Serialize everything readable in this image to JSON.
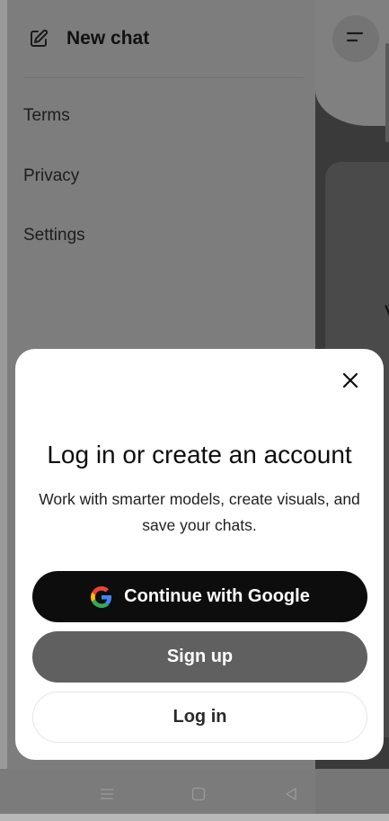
{
  "sidebar": {
    "new_chat_label": "New chat",
    "new_chat_icon": "edit-icon",
    "links": {
      "terms": "Terms",
      "privacy": "Privacy",
      "settings": "Settings"
    }
  },
  "main": {
    "menu_icon": "menu-icon",
    "partial_text": "V"
  },
  "modal": {
    "title": "Log in or create an account",
    "subtitle": "Work with smarter models, create visuals, and save your chats.",
    "close_icon": "close-icon",
    "google_button_label": "Continue with Google",
    "signup_button_label": "Sign up",
    "login_button_label": "Log in"
  },
  "nav_bar": {
    "icons": [
      "menu-lines-icon",
      "home-square-icon",
      "back-triangle-icon"
    ]
  },
  "colors": {
    "primary_button": "#0d0d0d",
    "signup_button": "#606060",
    "modal_background": "#ffffff",
    "google_blue": "#4285F4",
    "google_red": "#EA4335",
    "google_yellow": "#FBBC05",
    "google_green": "#34A853"
  }
}
